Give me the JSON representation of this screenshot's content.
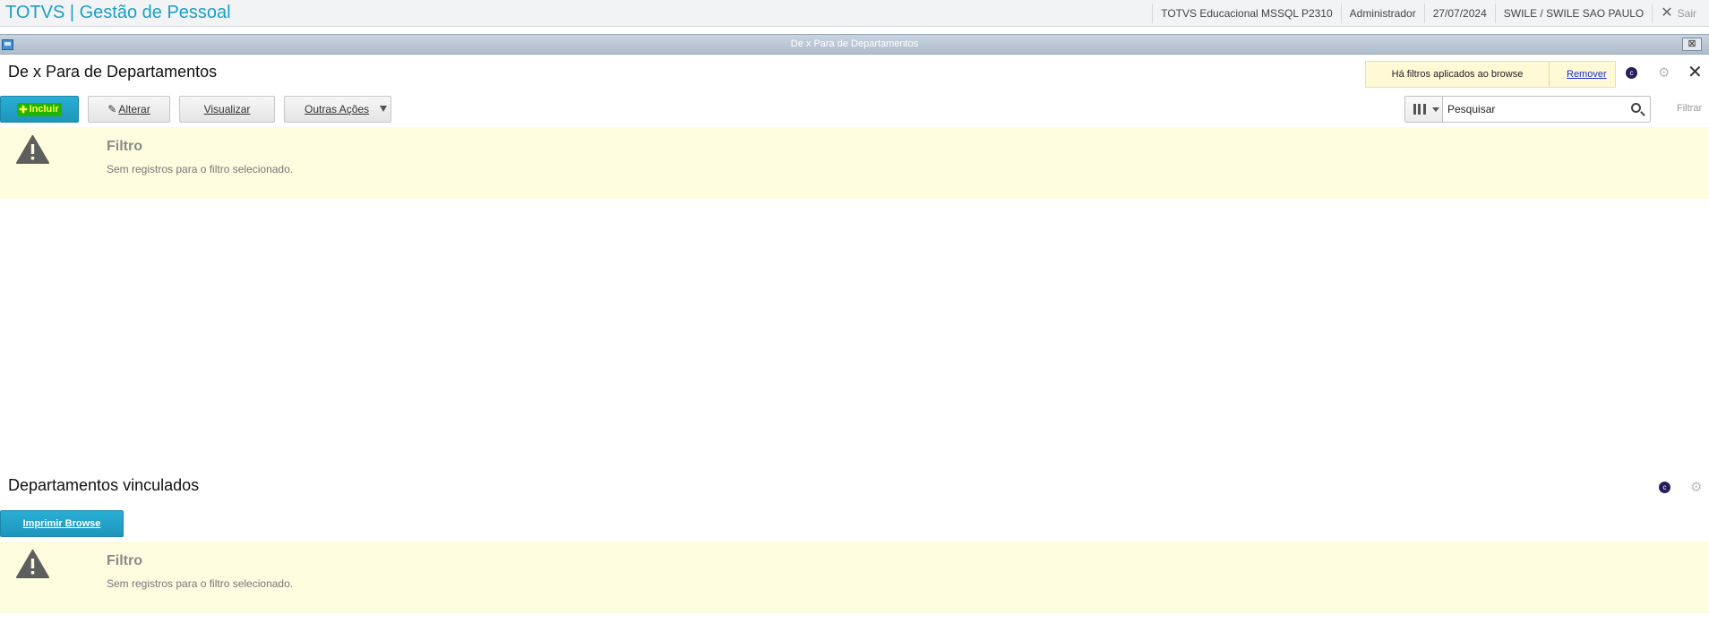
{
  "header": {
    "app_title": "TOTVS | Gestão de Pessoal",
    "environment": "TOTVS Educacional MSSQL P2310",
    "user": "Administrador",
    "date": "27/07/2024",
    "company": "SWILE / SWILE SAO PAULO",
    "logout_label": "Sair"
  },
  "window": {
    "title": "De x Para de Departamentos",
    "close_label": "⊠"
  },
  "browse_top": {
    "title": "De x Para de Departamentos",
    "filter_notice": "Há filtros aplicados ao browse",
    "remove_label": "Remover",
    "toolbar": {
      "incluir_label": "Incluir",
      "alterar_label": "Alterar",
      "visualizar_label": "Visualizar",
      "outras_label": "Outras Ações"
    },
    "search": {
      "placeholder": "Pesquisar",
      "filter_label": "Filtrar"
    },
    "empty": {
      "title": "Filtro",
      "message": "Sem registros para o filtro selecionado."
    }
  },
  "browse_bottom": {
    "title": "Departamentos vinculados",
    "print_label": "Imprimir Browse",
    "empty": {
      "title": "Filtro",
      "message": "Sem registros para o filtro selecionado."
    }
  },
  "icons": {
    "warning": "warning-triangle-icon",
    "settings": "gear-icon",
    "close": "close-icon",
    "search": "search-icon",
    "columns": "columns-icon"
  },
  "colors": {
    "brand": "#1a9fc4",
    "primary_button": "#1e95bd",
    "notice_bg": "#fefcdf",
    "link": "#1d2fd4"
  }
}
